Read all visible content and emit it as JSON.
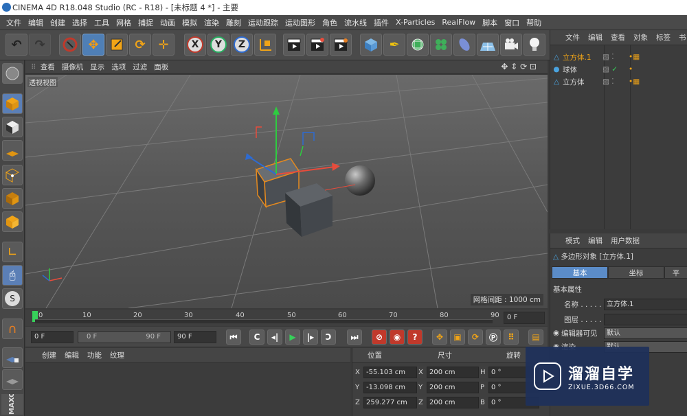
{
  "window": {
    "title": "CINEMA 4D R18.048 Studio (RC - R18) - [未标题 4 *] - 主要"
  },
  "menubar": {
    "items": [
      "文件",
      "编辑",
      "创建",
      "选择",
      "工具",
      "网格",
      "捕捉",
      "动画",
      "模拟",
      "渲染",
      "雕刻",
      "运动跟踪",
      "运动图形",
      "角色",
      "流水线",
      "插件",
      "X-Particles",
      "RealFlow",
      "脚本",
      "窗口",
      "帮助"
    ]
  },
  "toolbar": {
    "axis_x": "X",
    "axis_y": "Y",
    "axis_z": "Z"
  },
  "viewport": {
    "menu": [
      "查看",
      "摄像机",
      "显示",
      "选项",
      "过滤",
      "面板"
    ],
    "label": "透视视图",
    "grid_spacing": "网格间距 : 1000 cm"
  },
  "timeline": {
    "ticks": [
      "0",
      "10",
      "20",
      "30",
      "40",
      "50",
      "60",
      "70",
      "80",
      "90"
    ],
    "current_frame": "0 F",
    "start_frame": "0 F",
    "range_start": "0 F",
    "range_end": "90 F",
    "end_frame": "90 F"
  },
  "material_panel": {
    "menu": [
      "创建",
      "编辑",
      "功能",
      "纹理"
    ]
  },
  "coord_panel": {
    "headers": {
      "position": "位置",
      "size": "尺寸",
      "rotation": "旋转"
    },
    "rows": [
      {
        "axis": "X",
        "pos": "-55.103 cm",
        "size_axis": "X",
        "size": "200 cm",
        "rot_axis": "H",
        "rot": "0 °"
      },
      {
        "axis": "Y",
        "pos": "-13.098 cm",
        "size_axis": "Y",
        "size": "200 cm",
        "rot_axis": "P",
        "rot": "0 °"
      },
      {
        "axis": "Z",
        "pos": "259.277 cm",
        "size_axis": "Z",
        "size": "200 cm",
        "rot_axis": "B",
        "rot": "0 °"
      }
    ]
  },
  "object_manager": {
    "menu": [
      "文件",
      "编辑",
      "查看",
      "对象",
      "标签",
      "书"
    ],
    "objects": [
      {
        "name": "立方体.1",
        "selected": true
      },
      {
        "name": "球体",
        "selected": false
      },
      {
        "name": "立方体",
        "selected": false
      }
    ]
  },
  "attribute_manager": {
    "menu": [
      "模式",
      "编辑",
      "用户数据"
    ],
    "object_title": "多边形对象 [立方体.1]",
    "tabs": [
      "基本",
      "坐标",
      "平"
    ],
    "section": "基本属性",
    "fields": [
      {
        "label": "名称 . . . . .",
        "value": "立方体.1"
      },
      {
        "label": "图层 . . . . .",
        "value": ""
      },
      {
        "label": "编辑器可见",
        "value": "默认"
      },
      {
        "label": "渲染",
        "value": "默认"
      }
    ]
  },
  "watermark": {
    "title": "溜溜自学",
    "url": "ZIXUE.3D66.COM"
  },
  "left_brand": "MAXON"
}
